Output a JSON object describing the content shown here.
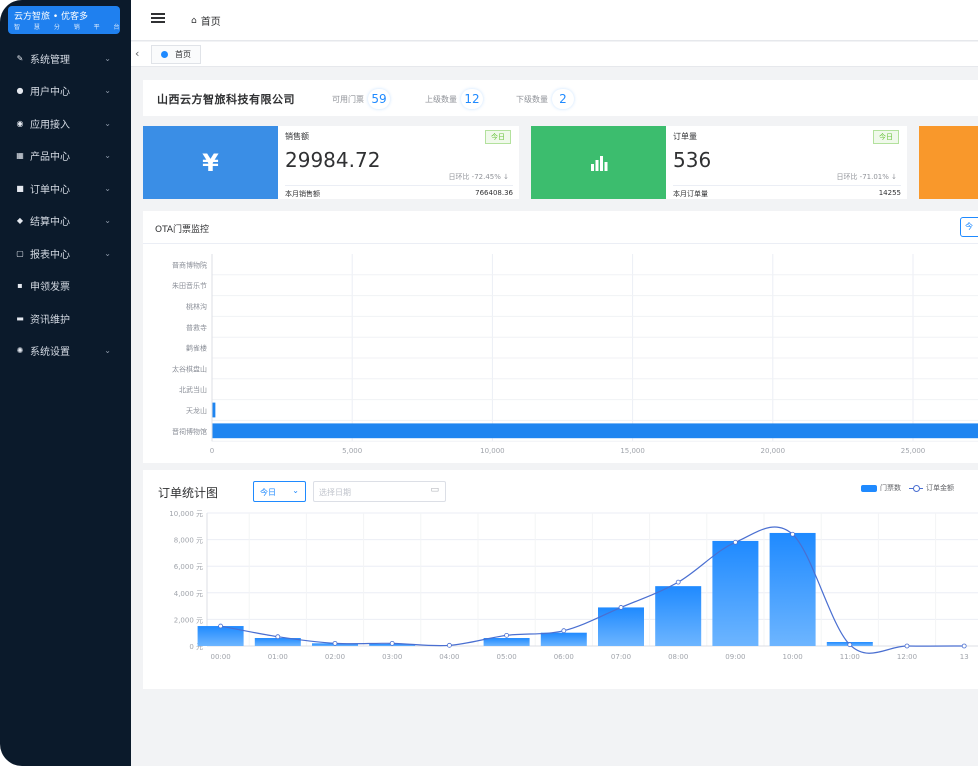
{
  "logo": {
    "line1": "云方智旅 • 优客多",
    "line2": "智 慧 分 销 平 台"
  },
  "sidebar": {
    "items": [
      {
        "label": "系统管理",
        "icon": "wrench-icon",
        "glyph": "✎",
        "has_arrow": true
      },
      {
        "label": "用户中心",
        "icon": "user-icon",
        "glyph": "●",
        "has_arrow": true
      },
      {
        "label": "应用接入",
        "icon": "app-icon",
        "glyph": "◉",
        "has_arrow": true
      },
      {
        "label": "产品中心",
        "icon": "grid-icon",
        "glyph": "▦",
        "has_arrow": true
      },
      {
        "label": "订单中心",
        "icon": "order-icon",
        "glyph": "■",
        "has_arrow": true
      },
      {
        "label": "结算中心",
        "icon": "tag-icon",
        "glyph": "◆",
        "has_arrow": true
      },
      {
        "label": "报表中心",
        "icon": "report-icon",
        "glyph": "▢",
        "has_arrow": true
      },
      {
        "label": "申领发票",
        "icon": "invoice-icon",
        "glyph": "▪",
        "has_arrow": false
      },
      {
        "label": "资讯维护",
        "icon": "message-icon",
        "glyph": "▬",
        "has_arrow": false
      },
      {
        "label": "系统设置",
        "icon": "settings-icon",
        "glyph": "✺",
        "has_arrow": true
      }
    ],
    "arrow": "⌄"
  },
  "topbar": {
    "breadcrumb": "首页",
    "home_icon": "⌂"
  },
  "tabs": {
    "back": "‹",
    "active": "首页"
  },
  "company": {
    "name": "山西云方智旅科技有限公司",
    "stats": [
      {
        "label": "可用门票",
        "value": "59"
      },
      {
        "label": "上级数量",
        "value": "12"
      },
      {
        "label": "下级数量",
        "value": "2"
      }
    ]
  },
  "cards": [
    {
      "title": "销售额",
      "badge": "今日",
      "value": "29984.72",
      "ratio": "日环比 -72.45%  ↓",
      "foot_label": "本月销售额",
      "foot_value": "766408.36",
      "color": "#3a8ee6",
      "glyph": "¥"
    },
    {
      "title": "订单量",
      "badge": "今日",
      "value": "536",
      "ratio": "日环比 -71.01%  ↓",
      "foot_label": "本月订单量",
      "foot_value": "14255",
      "color": "#3cbd6e",
      "glyph": "▁▃▅▂"
    },
    {
      "color": "#f9982b"
    }
  ],
  "ota": {
    "title": "OTA门票监控",
    "button": "今",
    "chart_data": {
      "type": "bar",
      "orientation": "horizontal",
      "categories": [
        "晋商博物院",
        "朱田音乐节",
        "桃林沟",
        "普救寺",
        "鹳雀楼",
        "太谷棋盘山",
        "北武当山",
        "天龙山",
        "晋祠博物馆"
      ],
      "values": [
        0,
        0,
        0,
        0,
        0,
        0,
        0,
        120,
        28000
      ],
      "xticks": [
        "0",
        "5,000",
        "10,000",
        "15,000",
        "20,000",
        "25,000"
      ],
      "xlim": [
        0,
        25000
      ]
    }
  },
  "orders": {
    "title": "订单统计图",
    "select_value": "今日",
    "select_chevron": "⌄",
    "date_placeholder": "选择日期",
    "calendar_icon": "▭",
    "legend": {
      "bar": "门票数",
      "line": "订单金额"
    },
    "chart_data": {
      "type": "bar",
      "categories": [
        "00:00",
        "01:00",
        "02:00",
        "03:00",
        "04:00",
        "05:00",
        "06:00",
        "07:00",
        "08:00",
        "09:00",
        "10:00",
        "11:00",
        "12:00",
        "13"
      ],
      "series": [
        {
          "name": "门票数",
          "type": "bar",
          "values": [
            1500,
            600,
            200,
            150,
            0,
            600,
            1000,
            2900,
            4500,
            7900,
            8500,
            300,
            0,
            0
          ]
        },
        {
          "name": "订单金额",
          "type": "line",
          "values": [
            1500,
            700,
            200,
            200,
            50,
            800,
            1150,
            2900,
            4800,
            7800,
            8400,
            100,
            0,
            0
          ]
        }
      ],
      "yticks": [
        "10,000 元",
        "8,000 元",
        "6,000 元",
        "4,000 元",
        "2,000 元",
        "0 元"
      ],
      "ylim": [
        0,
        10000
      ]
    }
  }
}
